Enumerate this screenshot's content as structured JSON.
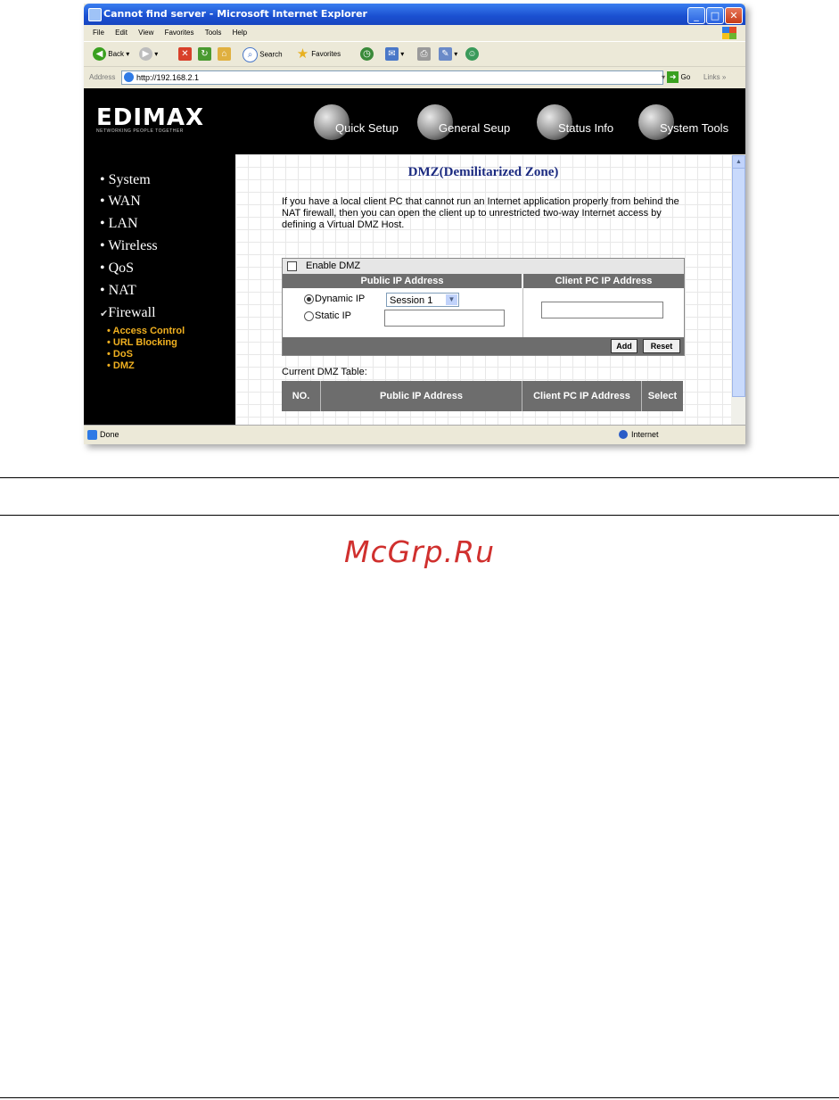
{
  "window": {
    "title": "Cannot find server - Microsoft Internet Explorer",
    "controls": [
      "minimize",
      "maximize",
      "close"
    ]
  },
  "menu": [
    "File",
    "Edit",
    "View",
    "Favorites",
    "Tools",
    "Help"
  ],
  "toolbar": {
    "back_label": "Back",
    "search_label": "Search",
    "favorites_label": "Favorites"
  },
  "address": {
    "label": "Address",
    "url": "http://192.168.2.1",
    "go_label": "Go",
    "links_label": "Links"
  },
  "header": {
    "logo": "EDIMAX",
    "tagline": "NETWORKING PEOPLE TOGETHER",
    "nav": [
      "Quick Setup",
      "General Seup",
      "Status Info",
      "System Tools"
    ]
  },
  "sidebar": {
    "sections": [
      "System",
      "WAN",
      "LAN",
      "Wireless",
      "QoS",
      "NAT",
      "Firewall"
    ],
    "firewall_items": [
      "Access Control",
      "URL Blocking",
      "DoS",
      "DMZ"
    ]
  },
  "main": {
    "title": "DMZ(Demilitarized Zone)",
    "description": "If you have a local client PC that cannot run an Internet application properly from behind the NAT firewall, then you can open the client up to unrestricted two-way Internet access by defining a Virtual DMZ Host.",
    "enable_label": "Enable DMZ",
    "col_public": "Public IP Address",
    "col_client": "Client PC IP Address",
    "dynamic_label": "Dynamic IP",
    "static_label": "Static IP",
    "session_value": "Session 1",
    "add_label": "Add",
    "reset_label": "Reset",
    "table_label": "Current DMZ Table:",
    "table_headers": [
      "NO.",
      "Public IP Address",
      "Client PC IP Address",
      "Select"
    ]
  },
  "statusbar": {
    "status": "Done",
    "zone": "Internet"
  },
  "watermark": "McGrp.Ru"
}
